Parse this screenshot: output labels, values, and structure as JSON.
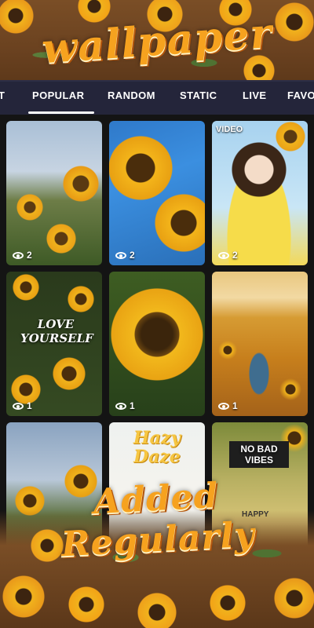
{
  "promo": {
    "headline": "wallpaper",
    "footer_line1": "Added",
    "footer_line2": "Regularly"
  },
  "tabs": [
    {
      "label": "T"
    },
    {
      "label": "POPULAR",
      "active": true
    },
    {
      "label": "RANDOM"
    },
    {
      "label": "STATIC"
    },
    {
      "label": "LIVE"
    },
    {
      "label": "FAVO"
    }
  ],
  "wallpapers": [
    {
      "views": "2"
    },
    {
      "views": "2"
    },
    {
      "views": "2",
      "tag": "VIDEO"
    },
    {
      "views": "1",
      "text": "LOVE YOURSELF"
    },
    {
      "views": "1"
    },
    {
      "views": "1"
    },
    {
      "views": ""
    },
    {
      "views": "",
      "text": "Hazy Daze"
    },
    {
      "views": "",
      "text": "NO BAD VIBES",
      "subtext": "HAPPY"
    }
  ],
  "colors": {
    "tab_bar": "#24253a",
    "accent": "#f6a21f",
    "background": "#141414"
  }
}
